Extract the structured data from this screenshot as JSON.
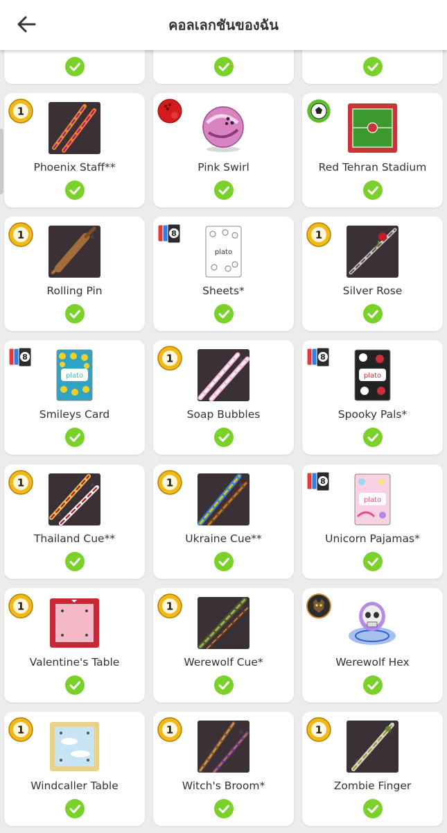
{
  "header": {
    "title": "คอลเลกชันของฉัน",
    "back_icon": "arrow-left-icon"
  },
  "colors": {
    "check_green": "#79d12a",
    "coin_gold": "#f1b915",
    "card_background": "#ffffff",
    "page_background": "#ececec"
  },
  "items": [
    {
      "name": "",
      "badge": "none",
      "thumb": "none",
      "collected": true
    },
    {
      "name": "",
      "badge": "none",
      "thumb": "none",
      "collected": true
    },
    {
      "name": "",
      "badge": "none",
      "thumb": "none",
      "collected": true
    },
    {
      "name": "Phoenix Staff**",
      "badge": "coin",
      "coin_value": "1",
      "thumb": "phoenix-staff",
      "collected": true
    },
    {
      "name": "Pink Swirl",
      "badge": "ball",
      "thumb": "pink-swirl-ball",
      "collected": true
    },
    {
      "name": "Red Tehran Stadium",
      "badge": "soccer",
      "thumb": "red-tehran-stadium-table",
      "collected": true
    },
    {
      "name": "Rolling Pin",
      "badge": "coin",
      "coin_value": "1",
      "thumb": "rolling-pin",
      "collected": true
    },
    {
      "name": "Sheets*",
      "badge": "cards",
      "card_digit": "8",
      "thumb": "sheets-card",
      "thumb_text": "plato",
      "collected": true
    },
    {
      "name": "Silver Rose",
      "badge": "coin",
      "coin_value": "1",
      "thumb": "silver-rose-cue",
      "collected": true
    },
    {
      "name": "Smileys Card",
      "badge": "cards",
      "card_digit": "8",
      "thumb": "smileys-card",
      "thumb_text": "plato",
      "collected": true
    },
    {
      "name": "Soap Bubbles",
      "badge": "coin",
      "coin_value": "1",
      "thumb": "soap-bubbles-cue",
      "collected": true
    },
    {
      "name": "Spooky Pals*",
      "badge": "cards",
      "card_digit": "8",
      "thumb": "spooky-pals-card",
      "thumb_text": "plato",
      "collected": true
    },
    {
      "name": "Thailand Cue**",
      "badge": "coin",
      "coin_value": "1",
      "thumb": "thailand-cue",
      "collected": true
    },
    {
      "name": "Ukraine Cue**",
      "badge": "coin",
      "coin_value": "1",
      "thumb": "ukraine-cue",
      "collected": true
    },
    {
      "name": "Unicorn Pajamas*",
      "badge": "cards",
      "card_digit": "8",
      "thumb": "unicorn-pajamas-card",
      "thumb_text": "plato",
      "collected": true
    },
    {
      "name": "Valentine's Table",
      "badge": "coin",
      "coin_value": "1",
      "thumb": "valentines-table",
      "collected": true
    },
    {
      "name": "Werewolf Cue*",
      "badge": "coin",
      "coin_value": "1",
      "thumb": "werewolf-cue",
      "collected": true
    },
    {
      "name": "Werewolf Hex",
      "badge": "werewolf",
      "thumb": "werewolf-hex-skull",
      "collected": true
    },
    {
      "name": "Windcaller Table",
      "badge": "coin",
      "coin_value": "1",
      "thumb": "windcaller-table",
      "collected": true
    },
    {
      "name": "Witch's Broom*",
      "badge": "coin",
      "coin_value": "1",
      "thumb": "witchs-broom-cue",
      "collected": true
    },
    {
      "name": "Zombie Finger",
      "badge": "coin",
      "coin_value": "1",
      "thumb": "zombie-finger-cue",
      "collected": true
    }
  ]
}
